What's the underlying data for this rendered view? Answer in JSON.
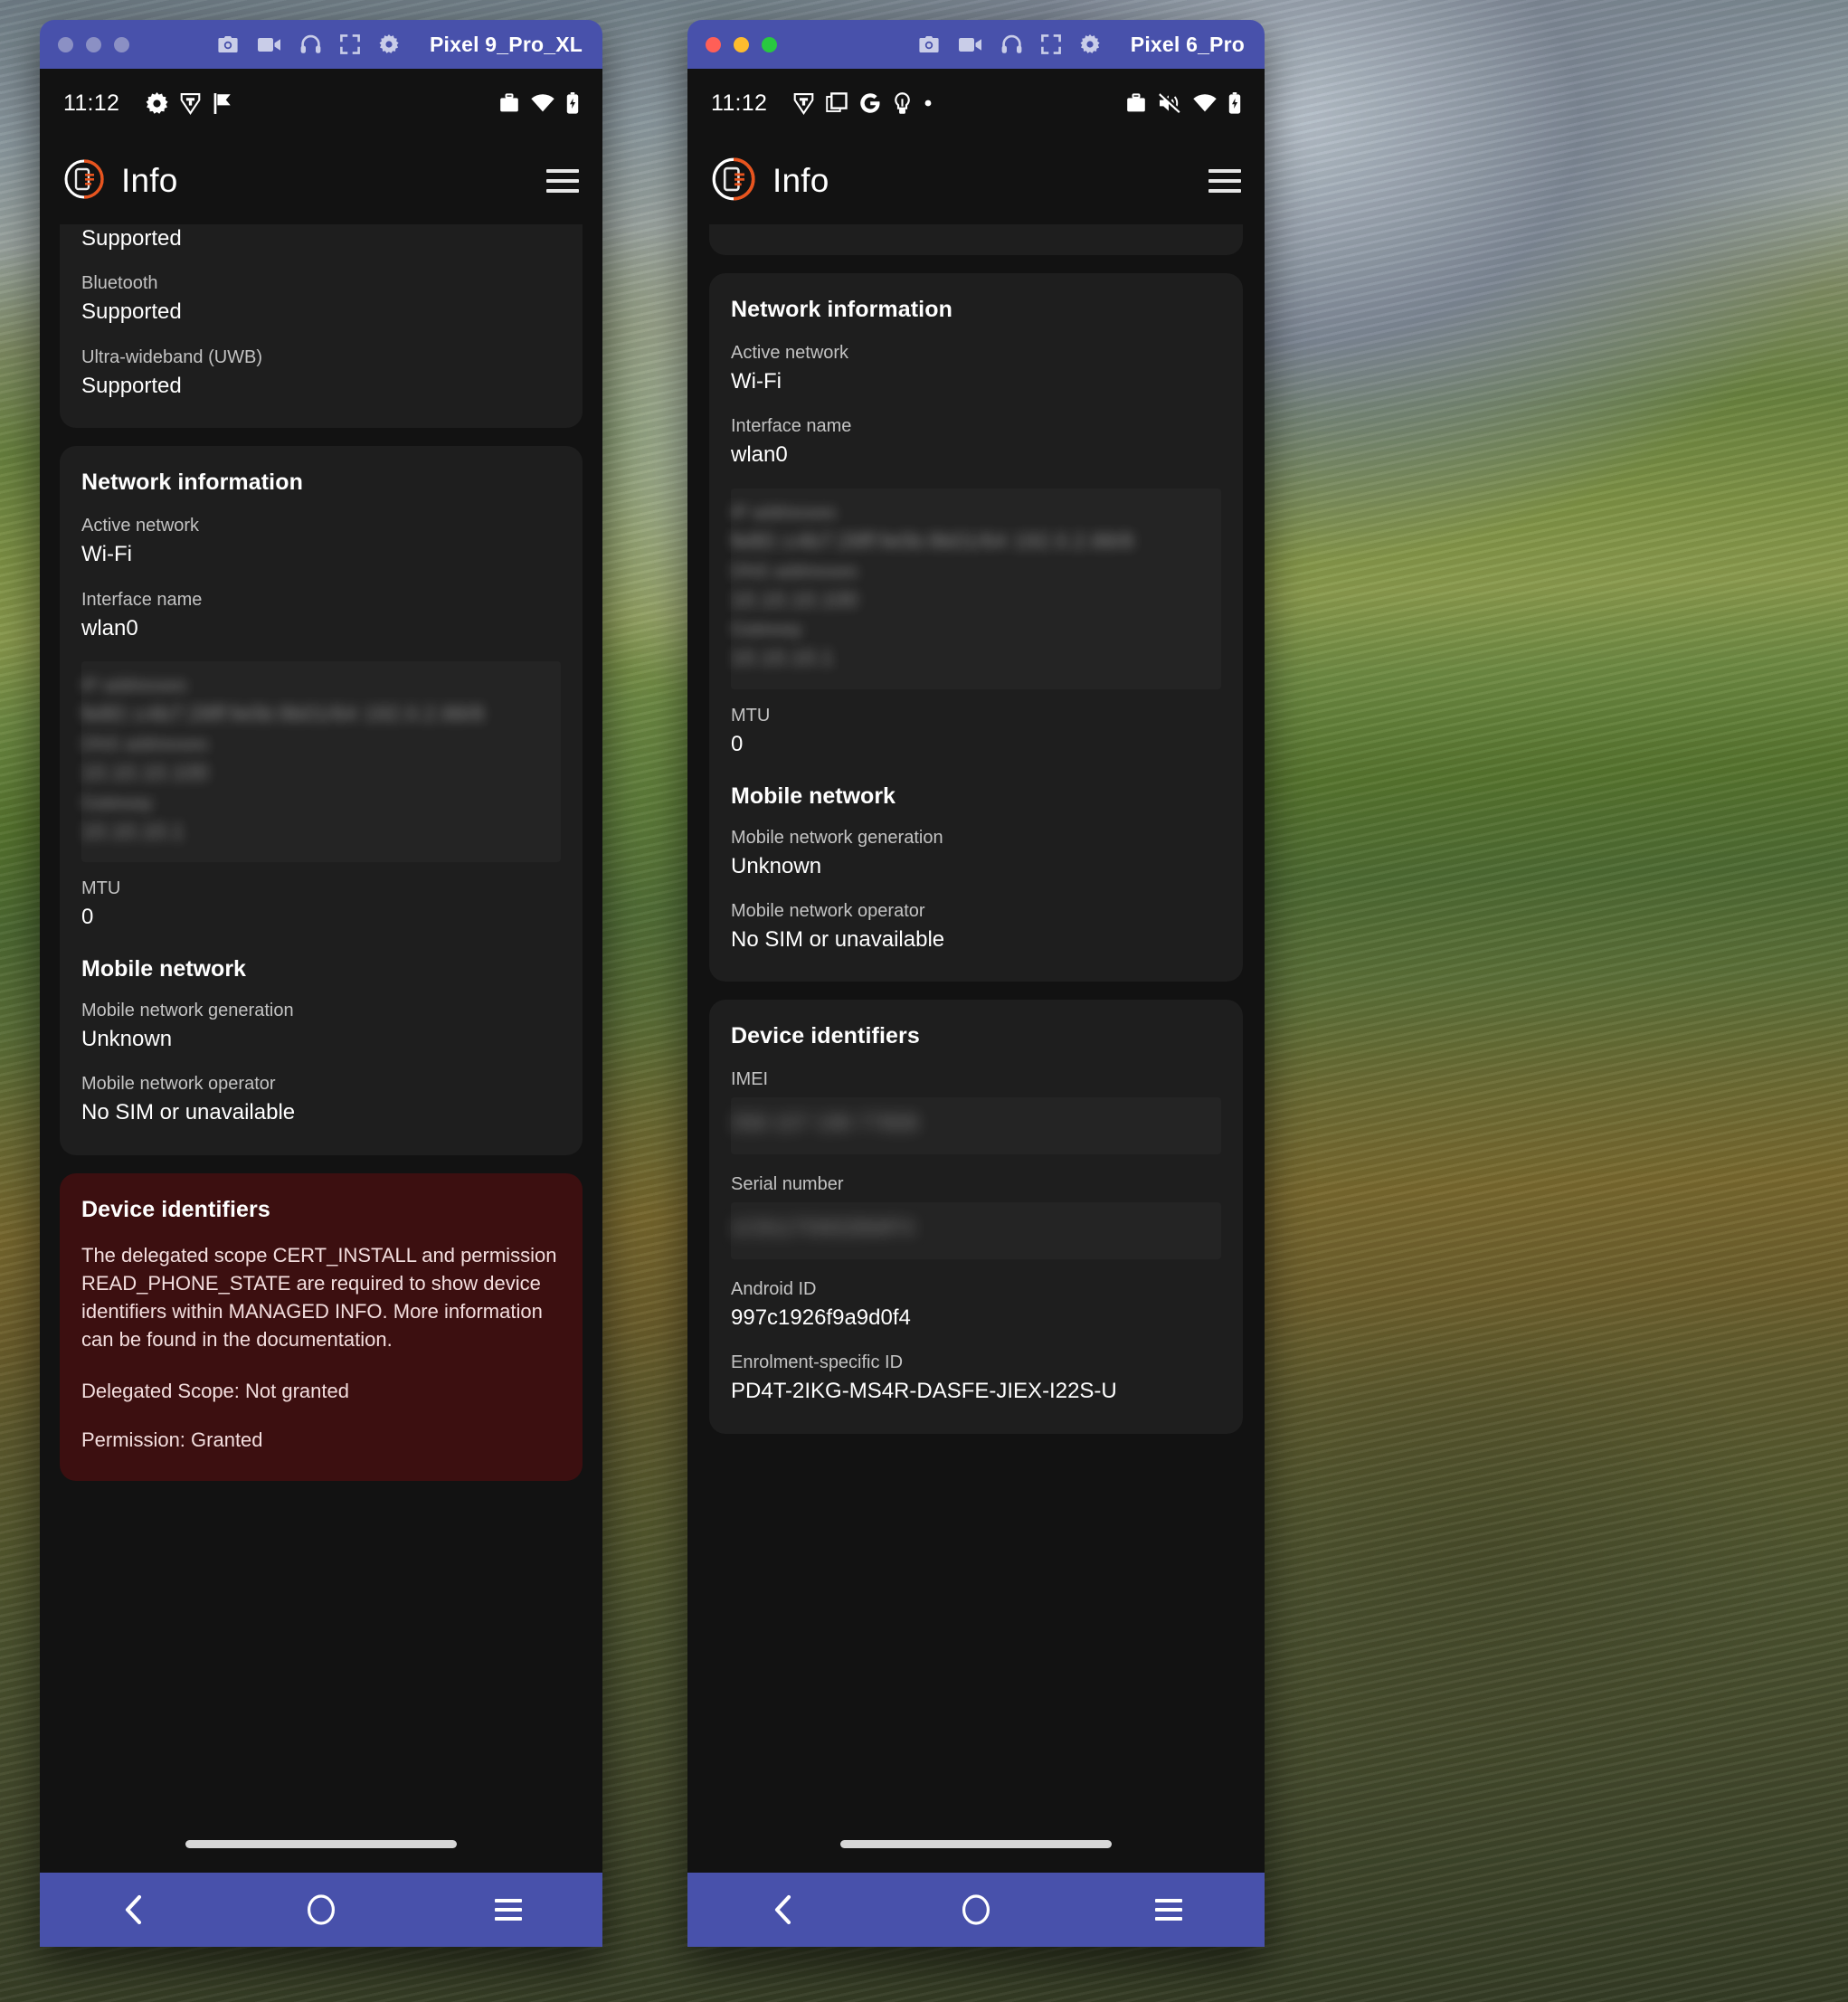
{
  "windows": [
    {
      "id": "pixel9",
      "title": "Pixel 9_Pro_XL",
      "toolbar_icons": [
        "camera-icon",
        "video-camera-icon",
        "headphones-icon",
        "fullscreen-icon",
        "gear-icon"
      ],
      "traffic_lights": [
        "minimize-dot",
        "zoom-dot",
        "close-dot"
      ],
      "statusbar": {
        "time": "11:12",
        "left_icons": [
          "gear-icon",
          "shield-icon",
          "flag-icon"
        ],
        "right_icons": [
          "work-briefcase-icon",
          "wifi-icon",
          "battery-icon"
        ]
      },
      "appbar": {
        "title": "Info",
        "logo": "app-logo-icon",
        "menu": "hamburger-menu-icon"
      },
      "cards": [
        {
          "type": "clipped",
          "fields": [
            {
              "value": "Supported"
            },
            {
              "label": "Bluetooth",
              "value": "Supported"
            },
            {
              "label": "Ultra-wideband (UWB)",
              "value": "Supported"
            }
          ]
        },
        {
          "type": "network",
          "title": "Network information",
          "fields": [
            {
              "label": "Active network",
              "value": "Wi-Fi"
            },
            {
              "label": "Interface name",
              "value": "wlan0"
            }
          ],
          "redacted": [
            {
              "label": "IP addresses",
              "value": "fe80::c4b7:28ff:fe0b:9b01/64 192.0.2.88/8"
            },
            {
              "label": "DNS addresses",
              "value": "10.10.10.100"
            },
            {
              "label": "Gateway",
              "value": "10.10.10.1"
            }
          ],
          "after_fields": [
            {
              "label": "MTU",
              "value": "0"
            }
          ],
          "subsection": {
            "title": "Mobile network",
            "fields": [
              {
                "label": "Mobile network generation",
                "value": "Unknown"
              },
              {
                "label": "Mobile network operator",
                "value": "No SIM or unavailable"
              }
            ]
          }
        },
        {
          "type": "danger",
          "title": "Device identifiers",
          "body": "The delegated scope CERT_INSTALL and permission READ_PHONE_STATE are required to show device identifiers within MANAGED INFO. More information can be found in the documentation.",
          "status_lines": [
            "Delegated Scope: Not granted",
            "Permission: Granted"
          ]
        }
      ],
      "navbar": [
        "back-icon",
        "home-icon",
        "recents-icon"
      ]
    },
    {
      "id": "pixel6",
      "title": "Pixel 6_Pro",
      "toolbar_icons": [
        "camera-icon",
        "video-camera-icon",
        "headphones-icon",
        "fullscreen-icon",
        "gear-icon"
      ],
      "traffic_lights": [
        "close-dot",
        "minimize-dot",
        "zoom-dot"
      ],
      "statusbar": {
        "time": "11:12",
        "left_icons": [
          "shield-icon",
          "copy-icon",
          "google-icon",
          "lightbulb-icon",
          "dot-icon"
        ],
        "right_icons": [
          "work-briefcase-icon",
          "volume-muted-icon",
          "wifi-icon",
          "battery-icon"
        ]
      },
      "appbar": {
        "title": "Info",
        "logo": "app-logo-icon",
        "menu": "hamburger-menu-icon"
      },
      "cards": [
        {
          "type": "clipped",
          "fields": []
        },
        {
          "type": "network",
          "title": "Network information",
          "fields": [
            {
              "label": "Active network",
              "value": "Wi-Fi"
            },
            {
              "label": "Interface name",
              "value": "wlan0"
            }
          ],
          "redacted": [
            {
              "label": "IP addresses",
              "value": "fe80::c4b7:28ff:fe0b:9b01/64 192.0.2.88/8"
            },
            {
              "label": "DNS addresses",
              "value": "10.10.10.100"
            },
            {
              "label": "Gateway",
              "value": "10.10.10.1"
            }
          ],
          "after_fields": [
            {
              "label": "MTU",
              "value": "0"
            }
          ],
          "subsection": {
            "title": "Mobile network",
            "fields": [
              {
                "label": "Mobile network generation",
                "value": "Unknown"
              },
              {
                "label": "Mobile network operator",
                "value": "No SIM or unavailable"
              }
            ]
          }
        },
        {
          "type": "identifiers",
          "title": "Device identifiers",
          "redacted": [
            {
              "label": "IMEI",
              "value": "358 107 196 77808"
            },
            {
              "label": "Serial number",
              "value": "1C811T00028WFX"
            }
          ],
          "fields": [
            {
              "label": "Android ID",
              "value": "997c1926f9a9d0f4"
            },
            {
              "label": "Enrolment-specific ID",
              "value": "PD4T-2IKG-MS4R-DASFE-JIEX-I22S-U"
            }
          ]
        }
      ],
      "navbar": [
        "back-icon",
        "home-icon",
        "recents-icon"
      ]
    }
  ],
  "colors": {
    "titlebar": "#4851ab",
    "navbar": "#4851ab",
    "screen_bg": "#121212",
    "card_bg": "#1e1e1e",
    "danger_card_bg": "#3c0f10",
    "accent_orange": "#e8541e"
  }
}
